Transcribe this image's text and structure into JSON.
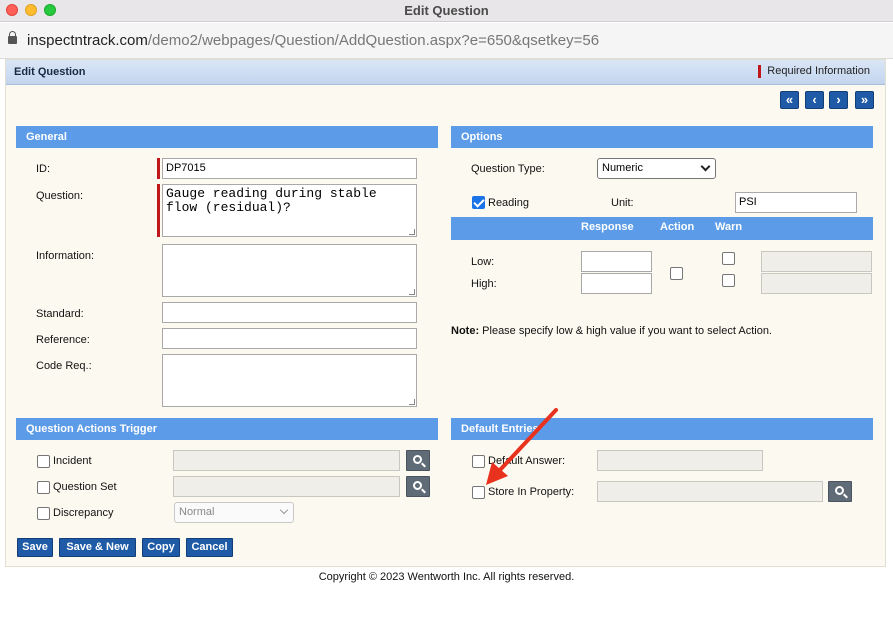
{
  "window": {
    "title": "Edit Question"
  },
  "browser": {
    "url_host": "inspectntrack.com",
    "url_path": "/demo2/webpages/Question/AddQuestion.aspx?e=650&qsetkey=56"
  },
  "header": {
    "title": "Edit Question",
    "required_info": "Required Information"
  },
  "nav": {
    "first": "«",
    "prev": "‹",
    "next": "›",
    "last": "»"
  },
  "general": {
    "title": "General",
    "id_label": "ID:",
    "id_value": "DP7015",
    "question_label": "Question:",
    "question_value": "Gauge reading during stable flow (residual)?",
    "information_label": "Information:",
    "standard_label": "Standard:",
    "reference_label": "Reference:",
    "code_label": "Code Req.:"
  },
  "options": {
    "title": "Options",
    "question_type_label": "Question Type:",
    "question_type_value": "Numeric",
    "reading_label": "Reading",
    "reading_checked": true,
    "unit_label": "Unit:",
    "unit_value": "PSI",
    "col_response": "Response",
    "col_action": "Action",
    "col_warn": "Warn",
    "low_label": "Low:",
    "high_label": "High:",
    "note_bold": "Note:",
    "note_text": " Please specify low & high value if you want to select Action."
  },
  "triggers": {
    "title": "Question Actions Trigger",
    "incident_label": "Incident",
    "question_set_label": "Question Set",
    "discrepancy_label": "Discrepancy",
    "discrepancy_select": "Normal"
  },
  "defaults": {
    "title": "Default Entries",
    "default_answer_label": "Default Answer:",
    "store_label": "Store In Property:"
  },
  "buttons": {
    "save": "Save",
    "save_new": "Save & New",
    "copy": "Copy",
    "cancel": "Cancel"
  },
  "footer": {
    "copyright": "Copyright © 2023 Wentworth Inc. All rights reserved."
  },
  "colors": {
    "section": "#5b9be8",
    "button": "#1f5aa6",
    "required": "#c0171d",
    "annotation_arrow": "#e8321e"
  }
}
